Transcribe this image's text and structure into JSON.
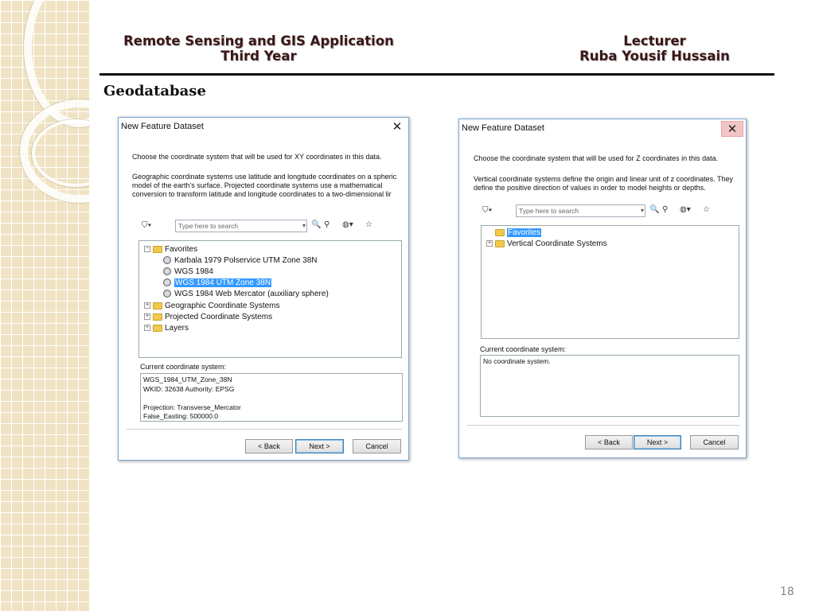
{
  "slide": {
    "header_left_line1": "Remote Sensing and GIS Application",
    "header_left_line2": "Third Year",
    "header_right_line1": "Lecturer",
    "header_right_line2": "Ruba Yousif Hussain",
    "section_title": "Geodatabase",
    "page_number": "18"
  },
  "dialog1": {
    "title": "New Feature Dataset",
    "instruction": "Choose the coordinate system that will be used for XY coordinates in this data.",
    "description_lines": [
      "Geographic coordinate systems use latitude and longitude coordinates on a spheric",
      "model of the earth's surface. Projected coordinate systems use a mathematical",
      "conversion to transform latitude and longitude coordinates to a two-dimensional lir"
    ],
    "search_placeholder": "Type here to search",
    "tree": {
      "favorites": "Favorites",
      "fav_items": [
        "Karbala 1979 Polservice UTM Zone 38N",
        "WGS 1984",
        "WGS 1984 UTM Zone 38N",
        "WGS 1984 Web Mercator (auxiliary sphere)"
      ],
      "geographic": "Geographic Coordinate Systems",
      "projected": "Projected Coordinate Systems",
      "layers": "Layers"
    },
    "current_label": "Current coordinate system:",
    "current_lines": [
      "WGS_1984_UTM_Zone_38N",
      "WKID: 32638 Authority: EPSG",
      "",
      "Projection: Transverse_Mercator",
      "False_Easting: 500000.0"
    ],
    "back_label": "< Back",
    "next_label": "Next >",
    "cancel_label": "Cancel"
  },
  "dialog2": {
    "title": "New Feature Dataset",
    "instruction": "Choose the coordinate system that will be used for Z coordinates in this data.",
    "description_lines": [
      "Vertical coordinate systems define the origin and linear unit of z coordinates. They",
      "define the positive direction of values in order to model heights or depths."
    ],
    "search_placeholder": "Type here to search",
    "tree": {
      "favorites": "Favorites",
      "vertical": "Vertical Coordinate Systems"
    },
    "current_label": "Current coordinate system:",
    "current_value": "No coordinate system.",
    "back_label": "< Back",
    "next_label": "Next >",
    "cancel_label": "Cancel"
  },
  "icons": {
    "filter": "filter-icon",
    "search": "magnifier-icon",
    "globe": "globe-icon",
    "favorite": "star-icon"
  }
}
